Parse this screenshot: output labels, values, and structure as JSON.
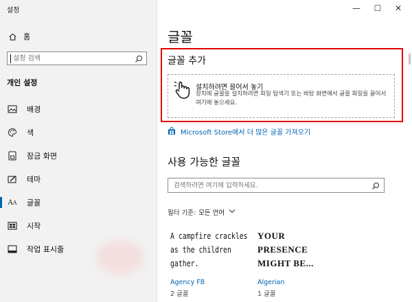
{
  "window": {
    "title": "설정",
    "controls": {
      "minimize": "—",
      "maximize": "☐",
      "close": "✕"
    }
  },
  "sidebar": {
    "home_label": "홈",
    "search_placeholder": "설정 검색",
    "section_title": "개인 설정",
    "items": [
      {
        "label": "배경",
        "icon": "image-icon"
      },
      {
        "label": "색",
        "icon": "palette-icon"
      },
      {
        "label": "잠금 화면",
        "icon": "lock-screen-icon"
      },
      {
        "label": "테마",
        "icon": "theme-icon"
      },
      {
        "label": "글꼴",
        "icon": "font-icon",
        "active": true
      },
      {
        "label": "시작",
        "icon": "start-icon"
      },
      {
        "label": "작업 표시줄",
        "icon": "taskbar-icon"
      }
    ]
  },
  "main": {
    "page_title": "글꼴",
    "add_font": {
      "heading": "글꼴 추가",
      "drop_title": "설치하려면 끌어서 놓기",
      "drop_desc": "장치에 글꼴을 설치하려면 파일 탐색기 또는 바탕 화면에서 글꼴 파일을 끌어서 여기에 놓으세요."
    },
    "store_link": "Microsoft Store에서 더 많은 글꼴 가져오기",
    "available_heading": "사용 가능한 글꼴",
    "font_search_placeholder": "검색하려면 여기에 입력하세요.",
    "filter_label": "필터 기준:",
    "filter_value": "모든 언어",
    "fonts": [
      {
        "preview": "A campfire crackles as the children gather.",
        "name": "Agency FB",
        "count": "2 글꼴"
      },
      {
        "preview": "YOUR PRESENCE MIGHT BE...",
        "name": "Algerian",
        "count": "1 글꼴"
      }
    ]
  },
  "colors": {
    "accent": "#0063b1",
    "highlight_border": "#e00000",
    "sidebar_bg": "#f2f2f2"
  }
}
